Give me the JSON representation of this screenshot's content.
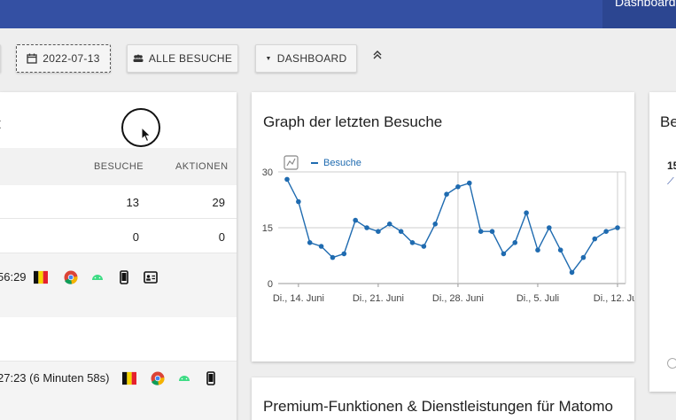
{
  "header": {
    "tab_label": "Dashboard"
  },
  "toolbar": {
    "date": "2022-07-13",
    "segment": "ALLE BESUCHE",
    "dashboard": "DASHBOARD"
  },
  "left_widget": {
    "title_fragment": "t",
    "columns": [
      "BESUCHE",
      "AKTIONEN"
    ],
    "rows": [
      {
        "visits": "13",
        "actions": "29"
      },
      {
        "visits": "0",
        "actions": "0"
      }
    ],
    "visitors": [
      {
        "time_fragment": "56:29"
      },
      {
        "time_fragment": "27:23 (6 Minuten 58s)"
      }
    ]
  },
  "graph_widget": {
    "title": "Graph der letzten Besuche",
    "legend_icon": "evolution-graph-icon",
    "chart_data": {
      "type": "line",
      "series": [
        {
          "name": "Besuche",
          "values": [
            28,
            22,
            11,
            10,
            7,
            8,
            17,
            15,
            14,
            16,
            14,
            11,
            10,
            16,
            24,
            26,
            27,
            14,
            14,
            8,
            11,
            19,
            9,
            15,
            9,
            3,
            7,
            12,
            14,
            15
          ]
        }
      ],
      "x_start": "2022-06-13",
      "x_tick_labels": [
        "Di., 14. Juni",
        "Di., 21. Juni",
        "Di., 28. Juni",
        "Di., 5. Juli",
        "Di., 12. Juli"
      ],
      "y_tick_labels": [
        "30",
        "15",
        "0"
      ],
      "ylim": [
        0,
        30
      ],
      "grid": true,
      "legend_position": "top-left",
      "color": "#1f6bb0"
    }
  },
  "right_widget": {
    "title_fragment": "Be",
    "value_fragment": "15"
  },
  "premium_widget": {
    "title": "Premium-Funktionen & Dienstleistungen für Matomo"
  }
}
